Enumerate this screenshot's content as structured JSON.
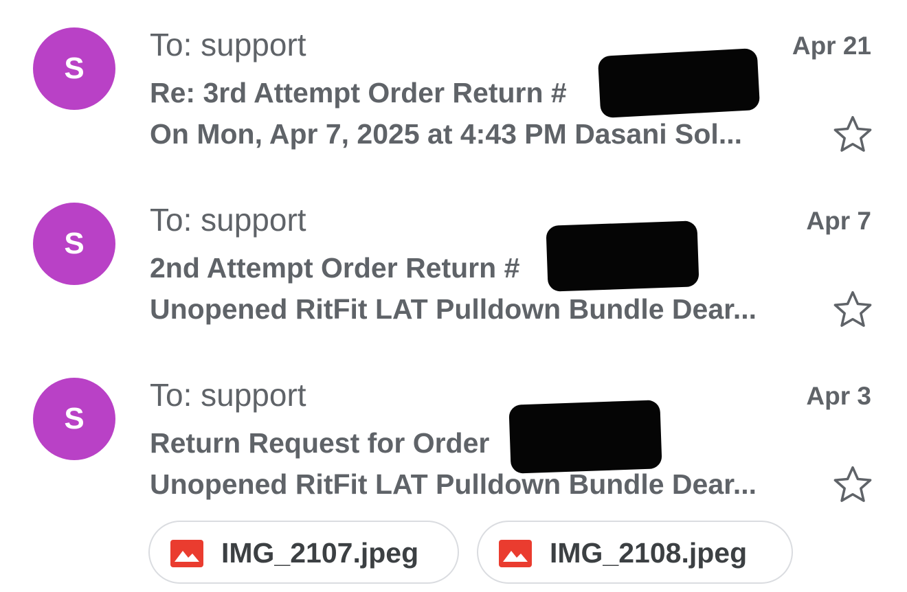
{
  "emails": [
    {
      "avatar_letter": "S",
      "recipient": "To: support",
      "date": "Apr 21",
      "subject": "Re: 3rd Attempt Order Return #",
      "snippet": "On Mon, Apr 7, 2025 at 4:43 PM Dasani Sol...",
      "starred": false
    },
    {
      "avatar_letter": "S",
      "recipient": "To: support",
      "date": "Apr 7",
      "subject": "2nd Attempt Order Return #",
      "snippet": "Unopened RitFit LAT Pulldown Bundle Dear...",
      "starred": false
    },
    {
      "avatar_letter": "S",
      "recipient": "To: support",
      "date": "Apr 3",
      "subject": "Return Request for Order",
      "snippet": "Unopened RitFit LAT Pulldown Bundle Dear...",
      "starred": false
    }
  ],
  "attachments": [
    {
      "name": "IMG_2107.jpeg",
      "icon": "image-file-icon"
    },
    {
      "name": "IMG_2108.jpeg",
      "icon": "image-file-icon"
    }
  ],
  "colors": {
    "avatar": "#b941c6",
    "text": "#5f6368",
    "attachment_icon": "#ea3c2f",
    "redaction": "#050505"
  }
}
